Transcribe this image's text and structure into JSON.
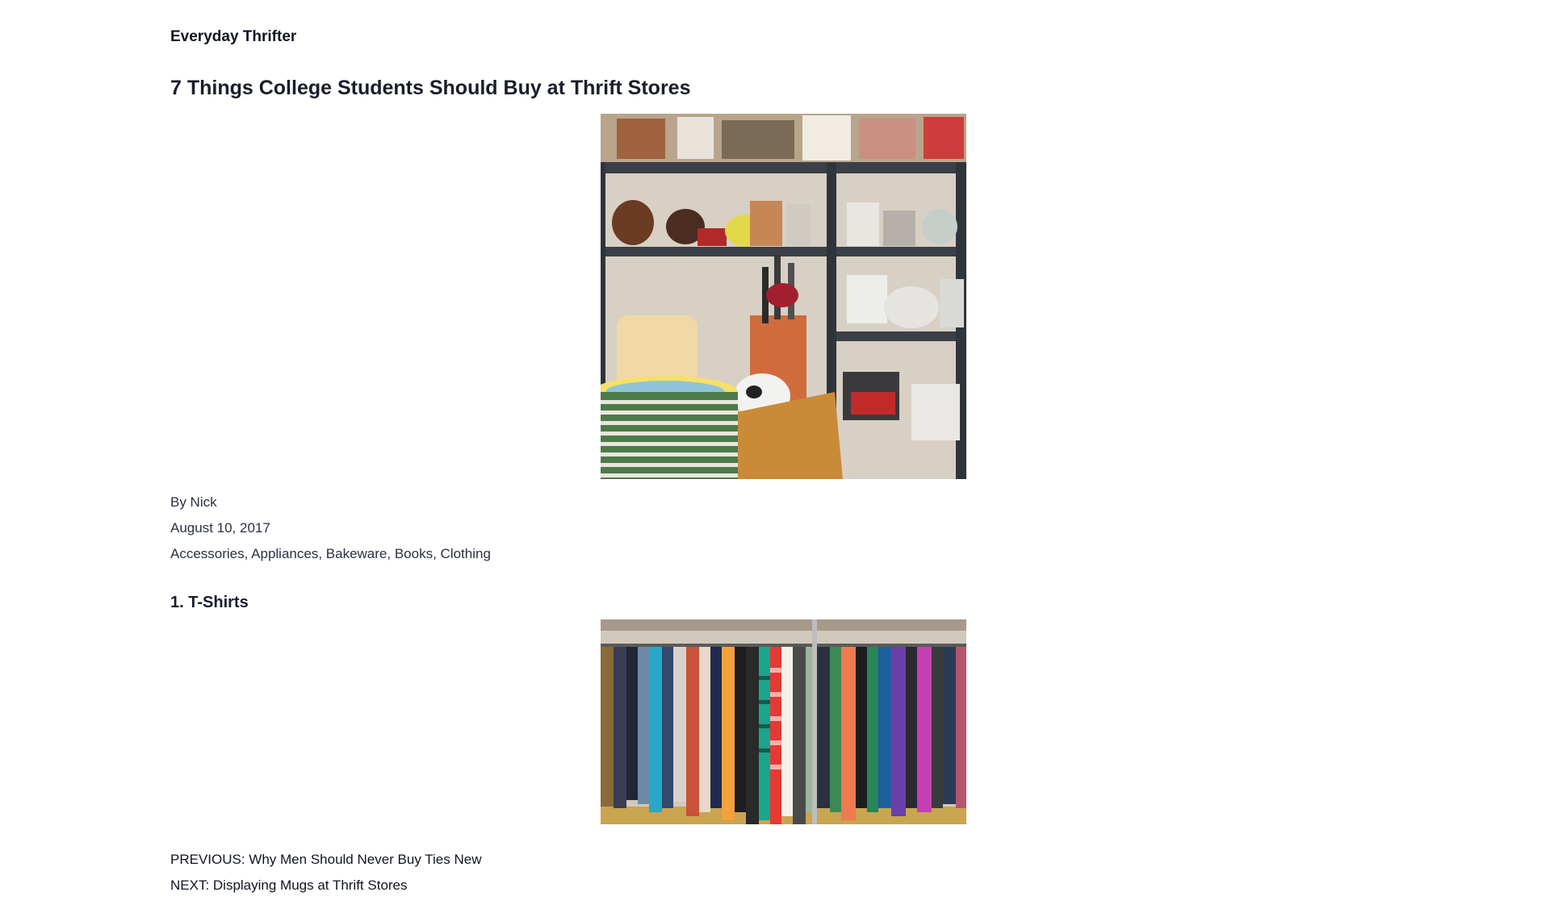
{
  "site": {
    "title": "Everyday Thrifter"
  },
  "post": {
    "title": "7 Things College Students Should Buy at Thrift Stores",
    "author_line": "By Nick",
    "date": "August 10, 2017",
    "categories": [
      "Accessories",
      "Appliances",
      "Bakeware",
      "Books",
      "Clothing"
    ],
    "separator": ", "
  },
  "sections": [
    {
      "heading": "1. T-Shirts"
    }
  ],
  "navigation": {
    "previous": "PREVIOUS: Why Men Should Never Buy Ties New",
    "next": "NEXT: Displaying Mugs at Thrift Stores"
  }
}
